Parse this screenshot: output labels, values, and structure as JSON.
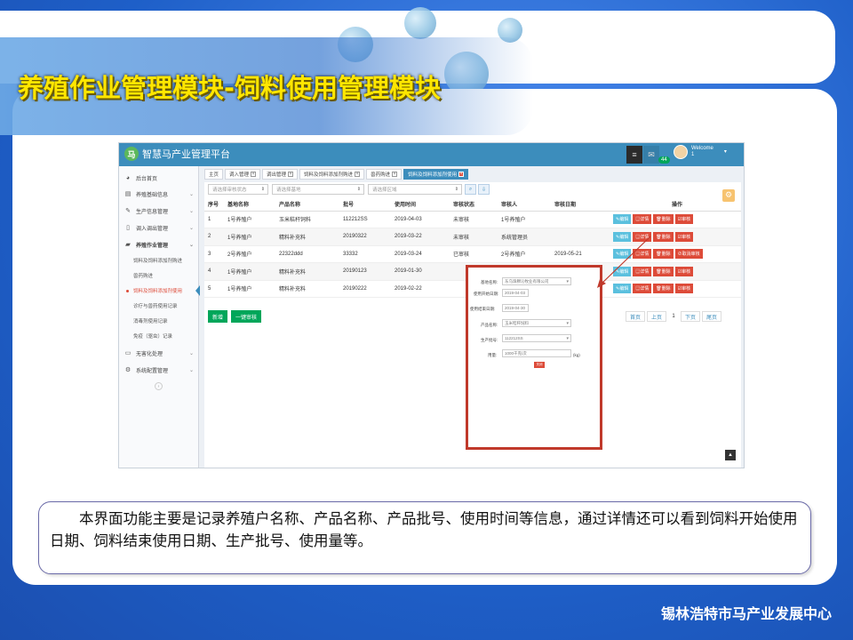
{
  "slide": {
    "title": "养殖作业管理模块-饲料使用管理模块",
    "footer": "锡林浩特市马产业发展中心",
    "description": "本界面功能主要是记录养殖户名称、产品名称、产品批号、使用时间等信息，通过详情还可以看到饲料开始使用日期、饲料结束使用日期、生产批号、使用量等。",
    "colors": {
      "title": "#ffe600",
      "background": "#1e5fc8",
      "highlight_border": "#c0392b"
    }
  },
  "app": {
    "brand": "智慧马产业管理平台",
    "brand_logo_icon": "horse-logo-icon",
    "header": {
      "mail_count": "44",
      "welcome": "Welcome",
      "user": "1"
    },
    "sidebar": {
      "items": [
        {
          "label": "后台首页",
          "icon": "dashboard-icon"
        },
        {
          "label": "养殖基础信息",
          "icon": "table-icon"
        },
        {
          "label": "生产信息管理",
          "icon": "edit-icon"
        },
        {
          "label": "调入调出管理",
          "icon": "file-icon"
        },
        {
          "label": "养殖作业管理",
          "icon": "folder-icon"
        },
        {
          "label": "无害化处理",
          "icon": "monitor-icon"
        },
        {
          "label": "系统配置管理",
          "icon": "gear-icon"
        }
      ],
      "sub_items": [
        "饲料及饲料添加剂购进",
        "兽药购进",
        "饲料及饲料添加剂使用",
        "诊疗与兽药使用记录",
        "消毒剂使用记录",
        "免疫（驱虫）记录"
      ]
    },
    "tabs": [
      "主页",
      "调入管理",
      "调出管理",
      "饲料及饲料添加剂购进",
      "兽药购进",
      "饲料及饲料添加剂使用"
    ],
    "filters": {
      "audit_status_placeholder": "请选择审核状态",
      "base_placeholder": "请选择基地",
      "region_placeholder": "请选择区域"
    },
    "table": {
      "headers": [
        "序号",
        "基地名称",
        "产品名称",
        "批号",
        "使用时间",
        "审核状态",
        "审核人",
        "审核日期",
        "操作"
      ],
      "rows": [
        [
          "1",
          "1号养殖户",
          "玉米秸秆饲料",
          "112212SS",
          "2019-04-03",
          "未审核",
          "1号养殖户",
          ""
        ],
        [
          "2",
          "1号养殖户",
          "精料补充料",
          "20190322",
          "2019-03-22",
          "未审核",
          "系统管理员",
          ""
        ],
        [
          "3",
          "2号养殖户",
          "22322ddd",
          "33332",
          "2019-03-24",
          "已审核",
          "2号养殖户",
          "2019-05-21"
        ],
        [
          "4",
          "1号养殖户",
          "精料补充料",
          "20190123",
          "2019-01-30",
          "",
          "",
          ""
        ],
        [
          "5",
          "1号养殖户",
          "精料补充料",
          "20190222",
          "2019-02-22",
          "",
          "",
          ""
        ]
      ],
      "op_labels": {
        "edit": "编辑",
        "detail": "详情",
        "delete": "删除",
        "audit": "审核",
        "unaudit": "取消审核"
      }
    },
    "buttons": {
      "add": "新增",
      "batch_audit": "一键审核"
    },
    "pager": {
      "first": "首页",
      "prev": "上页",
      "current": "1",
      "next": "下页",
      "last": "尾页"
    },
    "popup": {
      "fields": [
        {
          "label": "基地名称:",
          "value": "东乌珠穆沁牧业有限公司"
        },
        {
          "label": "使用开始日期:",
          "value": "2019-04-03"
        },
        {
          "label": "使用结束日期:",
          "value": "2019-04-30"
        },
        {
          "label": "产品名称:",
          "value": "玉米秸秆饲料"
        },
        {
          "label": "生产批号:",
          "value": "112212SS"
        },
        {
          "label": "用量:",
          "value": "1000千克/次",
          "unit": "(kg)"
        }
      ],
      "close_label": "关闭"
    }
  }
}
